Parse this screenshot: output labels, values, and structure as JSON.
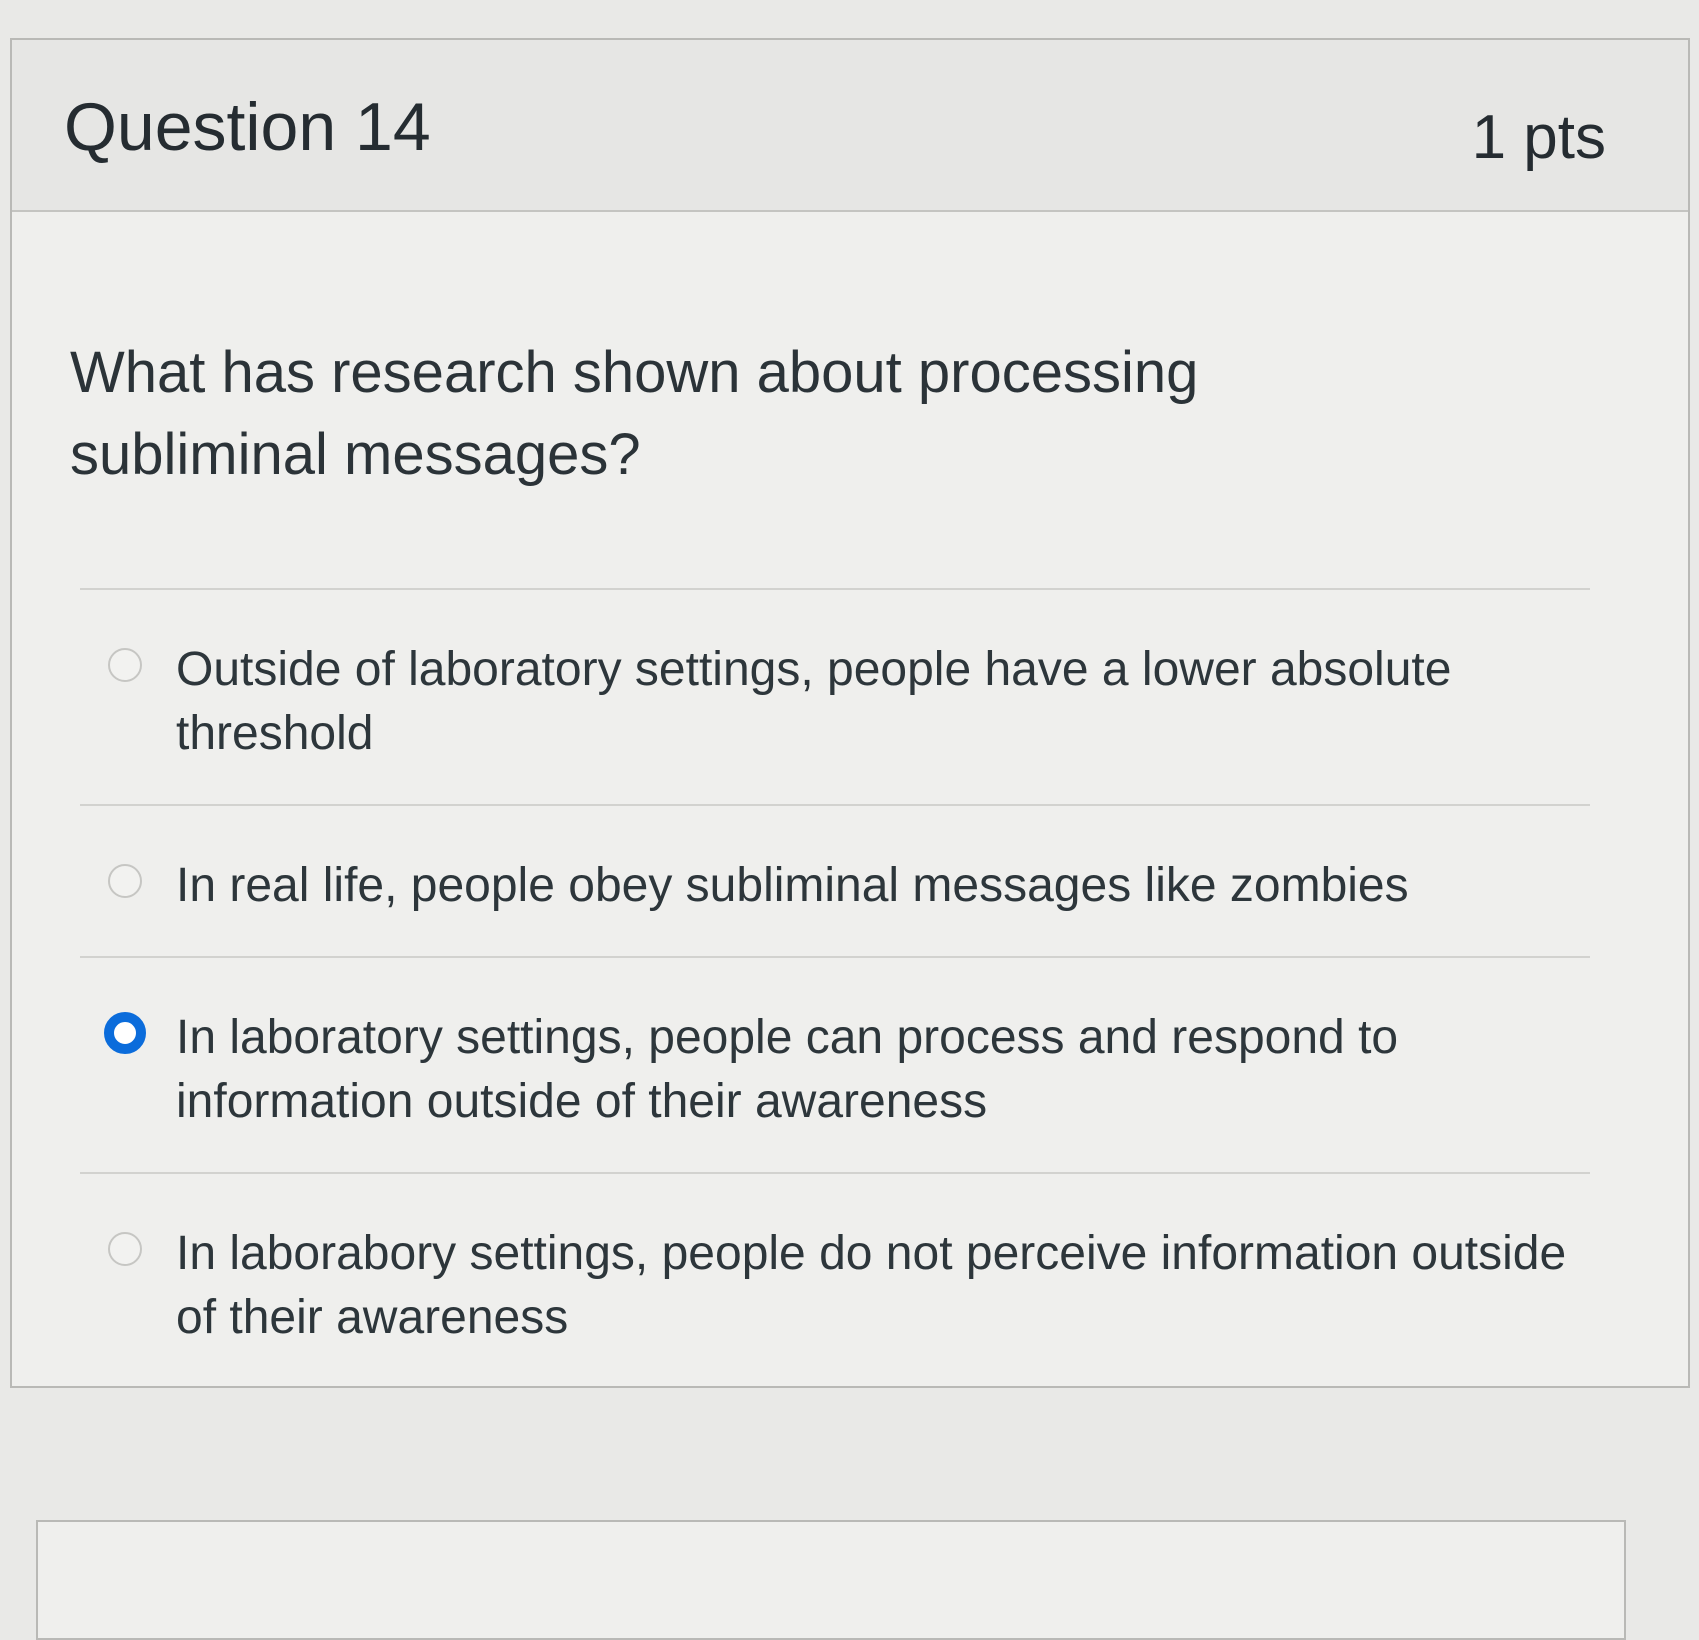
{
  "question": {
    "title": "Question 14",
    "points": "1 pts",
    "text": "What has research shown about processing subliminal messages?",
    "answers": [
      {
        "label": "Outside of laboratory settings, people have a lower absolute threshold",
        "selected": false
      },
      {
        "label": "In real life, people obey subliminal messages like zombies",
        "selected": false
      },
      {
        "label": "In laboratory settings, people can process and respond to information outside of their awareness",
        "selected": true
      },
      {
        "label": "In laborabory settings, people do not perceive information outside of their awareness",
        "selected": false
      }
    ]
  },
  "colors": {
    "selected_radio": "#0b6cdb",
    "page_background": "#e9e9e7",
    "card_background": "#efefed"
  }
}
